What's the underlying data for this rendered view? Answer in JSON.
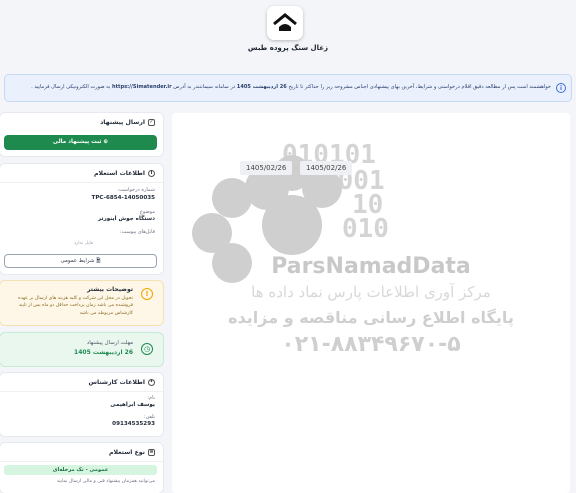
{
  "header": {
    "site_name": "زغال سنگ پروده طبس"
  },
  "notice": {
    "text_before": "خواهشمند است پس از مطالعه دقیق اقلام درخواستی و شرایط، آخرین بهای پیشنهادی اجناس مشروحه زیر را حداکثر تا تاریخ ",
    "deadline": "26 اردیبهشت 1405",
    "text_middle": " در سامانه سیمانتندر به آدرس ",
    "site": "https://Simatender.ir",
    "text_after": " به صورت الکترونیکی ارسال فرمایید ."
  },
  "watermark": {
    "digits_l1": "010101",
    "digits_l2": "0001",
    "digits_l3": "10",
    "digits_l4": "010",
    "brand": "ParsNamadData",
    "farsi_l1": "مرکز آوری اطلاعات پارس نماد داده ها",
    "farsi_l2": "پایگاه اطلاع رسانی مناقصه و مزایده",
    "phone": "۰۲۱-۸۸۳۴۹۶۷۰-۵",
    "date_left": "1405/02/26",
    "date_right": "1405/02/26"
  },
  "send_card": {
    "title": "ارسال پیشنهاد",
    "button": "ثبت پیشنهاد مالی"
  },
  "info_card": {
    "title": "اطلاعات استعلام",
    "req_label": "شماره درخواست:",
    "req_value": "TPC-6854-14050035",
    "subject_label": "موضوع",
    "subject_value": "دستگاه جوش اینورتر",
    "files_label": "فایل‌های پیوست:",
    "no_file": "فایل ندارد",
    "terms_button": "شرایط عمومی"
  },
  "notes_card": {
    "title": "توضیحات بیشتر",
    "text": "تحویل در محل این شرکت و کلیه هزینه های ارسال بر عهده فروشنده می باشد زمان پرداخت حداقل دو ماه پس از تایید کارشناس مربوطه می باشد"
  },
  "deadline_card": {
    "title": "مهلت ارسال پیشنهاد",
    "value": "26 اردیبهشت 1405"
  },
  "expert_card": {
    "title": "اطلاعات کارشناس",
    "name_label": "نام:",
    "name_value": "یوسف ابراهیمی",
    "phone_label": "تلفن:",
    "phone_value": "09134535293"
  },
  "type_card": {
    "title": "نوع استعلام",
    "badge": "عمومی - تک مرحله‌ای",
    "desc": "می‌توانید همزمان پیشنهاد فنی و مالی ارسال نمایید"
  },
  "colors": {
    "green": "#1e8a4e",
    "notice_bg": "#eaf1fd",
    "warn": "#f0a500"
  }
}
